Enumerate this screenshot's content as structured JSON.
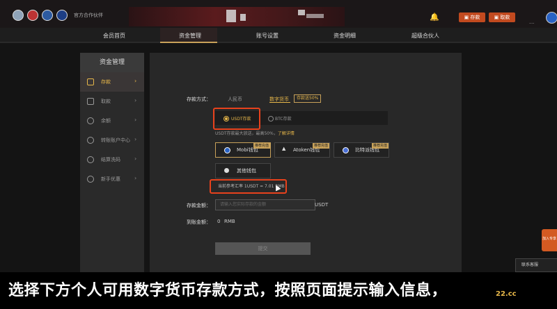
{
  "header": {
    "logo_text": "官方合作伙伴",
    "deposit_button": "存款",
    "withdraw_button": "取款",
    "user_name": "...."
  },
  "nav": {
    "items": [
      "会员首页",
      "资金管理",
      "账号设置",
      "资金明细",
      "超级合伙人"
    ],
    "active": "资金管理"
  },
  "sidebar": {
    "title": "资金管理",
    "items": [
      {
        "label": "存款",
        "icon": "deposit-icon",
        "active": true
      },
      {
        "label": "取款",
        "icon": "withdraw-icon",
        "active": false
      },
      {
        "label": "余额",
        "icon": "balance-icon",
        "active": false
      },
      {
        "label": "转账账户中心",
        "icon": "transfer-icon",
        "active": false
      },
      {
        "label": "结算洗码",
        "icon": "settlement-icon",
        "active": false
      },
      {
        "label": "新手优惠",
        "icon": "promo-icon",
        "active": false
      }
    ]
  },
  "form": {
    "method_label": "存款方式：",
    "tab_rmb": "人民币",
    "tab_crypto": "数字货币",
    "promo_badge": "存款送50%",
    "usdt_option": "USDT存款",
    "btc_option": "BTC存款",
    "hint_text": "USDT存款最大放送，最高50%，",
    "hint_link": "了解详情",
    "wallets": [
      {
        "label": "Mobi钱包",
        "tag": "推荐充值",
        "selected": true
      },
      {
        "label": "Atoken钱包",
        "tag": "推荐充值",
        "selected": false
      },
      {
        "label": "比特派钱包",
        "tag": "推荐充值",
        "selected": false
      },
      {
        "label": "其他钱包",
        "tag": "",
        "selected": false
      }
    ],
    "rate_text": "当前参考汇率 1USDT = 7.01 RMB",
    "amount_label": "存款金额：",
    "amount_placeholder": "请输入您实际存款的金额",
    "amount_unit": "USDT",
    "received_label": "到账金额：",
    "received_value": "0",
    "received_unit": "RMB",
    "submit_button": "提交"
  },
  "side_widgets": {
    "float_text": "加入专享",
    "customer_service": "联系客服"
  },
  "subtitle": "选择下方个人可用数字货币存款方式，按照页面提示输入信息，",
  "watermark": "22.cc",
  "colors": {
    "accent_gold": "#e8b84a",
    "highlight_red": "#e8421c",
    "button_orange": "#c24a1f"
  }
}
